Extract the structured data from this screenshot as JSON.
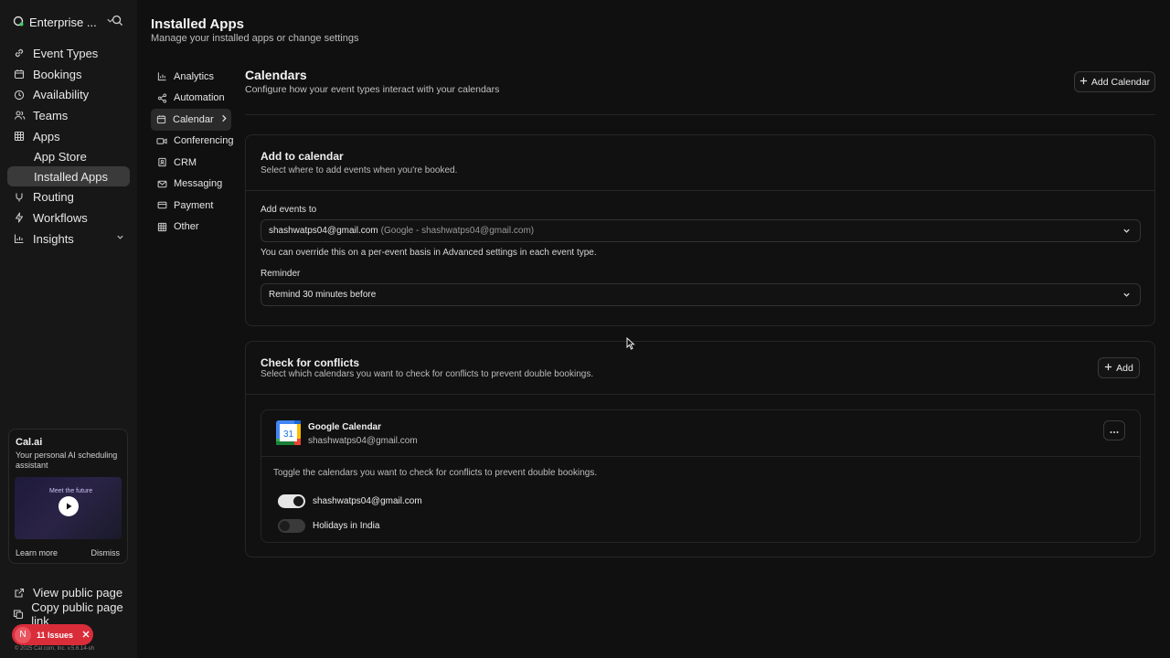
{
  "sidebar": {
    "org_name": "Enterprise ...",
    "nav": [
      {
        "label": "Event Types",
        "icon": "link-icon"
      },
      {
        "label": "Bookings",
        "icon": "calendar-icon"
      },
      {
        "label": "Availability",
        "icon": "clock-icon"
      },
      {
        "label": "Teams",
        "icon": "users-icon"
      },
      {
        "label": "Apps",
        "icon": "grid-icon"
      }
    ],
    "apps_sub": [
      {
        "label": "App Store"
      },
      {
        "label": "Installed Apps"
      }
    ],
    "nav2": [
      {
        "label": "Routing",
        "icon": "split-icon"
      },
      {
        "label": "Workflows",
        "icon": "zap-icon"
      },
      {
        "label": "Insights",
        "icon": "chart-icon"
      }
    ],
    "promo": {
      "title": "Cal.ai",
      "description": "Your personal AI scheduling assistant",
      "thumb_text": "Meet the future",
      "learn_more": "Learn more",
      "dismiss": "Dismiss"
    },
    "footer": [
      {
        "label": "View public page",
        "icon": "external-link-icon"
      },
      {
        "label": "Copy public page link",
        "icon": "copy-icon"
      }
    ],
    "issues": {
      "avatar": "N",
      "label": "11 Issues"
    },
    "copyright": "© 2025 Cal.com, Inc. v.5.6.14-sh"
  },
  "header": {
    "title": "Installed Apps",
    "subtitle": "Manage your installed apps or change settings"
  },
  "subnav": [
    {
      "label": "Analytics",
      "icon": "chart-icon"
    },
    {
      "label": "Automation",
      "icon": "share-icon"
    },
    {
      "label": "Calendar",
      "icon": "calendar-icon",
      "active": true
    },
    {
      "label": "Conferencing",
      "icon": "video-icon"
    },
    {
      "label": "CRM",
      "icon": "contact-icon"
    },
    {
      "label": "Messaging",
      "icon": "mail-icon"
    },
    {
      "label": "Payment",
      "icon": "credit-card-icon"
    },
    {
      "label": "Other",
      "icon": "grid-icon"
    }
  ],
  "calendars": {
    "title": "Calendars",
    "subtitle": "Configure how your event types interact with your calendars",
    "add_button": "Add Calendar"
  },
  "add_to_calendar": {
    "title": "Add to calendar",
    "subtitle": "Select where to add events when you're booked.",
    "add_events_label": "Add events to",
    "add_events_value": "shashwatps04@gmail.com",
    "add_events_detail": "(Google - shashwatps04@gmail.com)",
    "override_hint": "You can override this on a per-event basis in Advanced settings in each event type.",
    "reminder_label": "Reminder",
    "reminder_value": "Remind 30 minutes before"
  },
  "conflicts": {
    "title": "Check for conflicts",
    "subtitle": "Select which calendars you want to check for conflicts to prevent double bookings.",
    "add_button": "Add",
    "integration": {
      "name": "Google Calendar",
      "account": "shashwatps04@gmail.com",
      "logo_text": "31",
      "hint": "Toggle the calendars you want to check for conflicts to prevent double bookings.",
      "calendars": [
        {
          "label": "shashwatps04@gmail.com",
          "enabled": true
        },
        {
          "label": "Holidays in India",
          "enabled": false
        }
      ]
    }
  },
  "colors": {
    "accent_red": "#d92d3a",
    "google_blue": "#4285f4"
  }
}
